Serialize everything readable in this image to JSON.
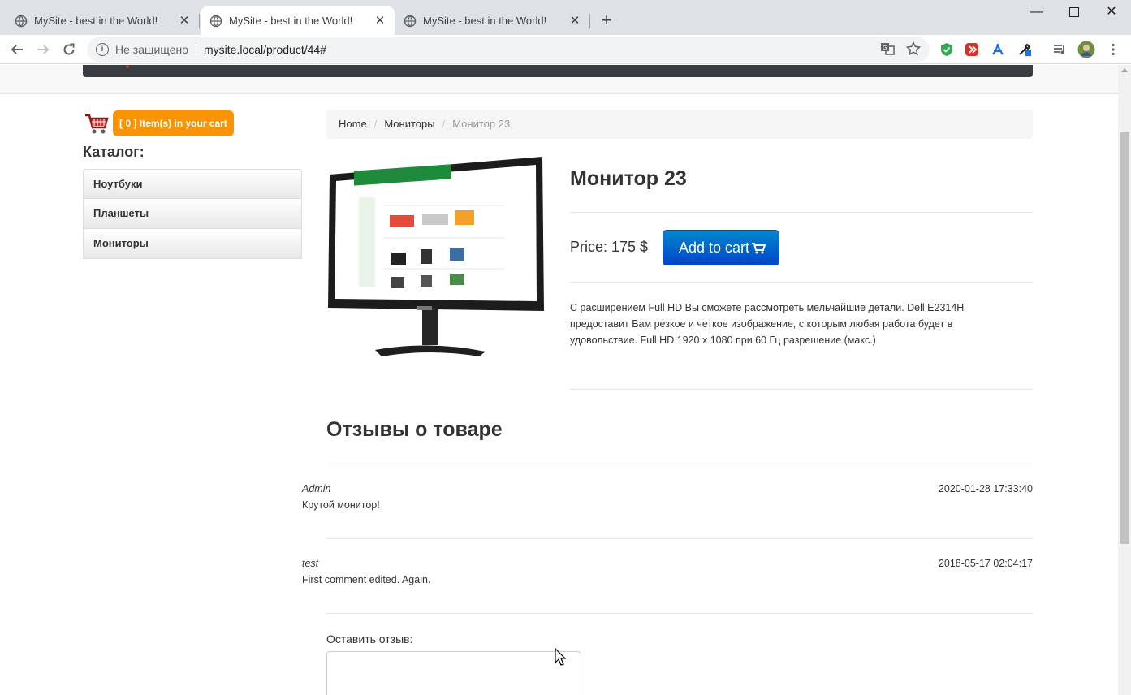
{
  "browser": {
    "tabs": [
      {
        "title": "MySite - best in the World!",
        "active": false
      },
      {
        "title": "MySite - best in the World!",
        "active": true
      },
      {
        "title": "MySite - best in the World!",
        "active": false
      }
    ],
    "new_tab_icon": "plus-icon",
    "window_controls": [
      "minimize-icon",
      "maximize-icon",
      "close-icon"
    ],
    "security_label": "Не защищено",
    "url": "mysite.local/product/44#",
    "extension_icons": [
      "translate-icon",
      "star-icon",
      "shield-icon",
      "extension-icon",
      "acrobat-icon",
      "eyedropper-icon",
      "media-icon",
      "avatar",
      "menu-icon"
    ]
  },
  "sidebar": {
    "cart_button": "[ 0 ] Item(s) in your cart",
    "catalog_title": "Каталог:",
    "catalog_items": [
      "Ноутбуки",
      "Планшеты",
      "Мониторы"
    ]
  },
  "breadcrumb": {
    "home": "Home",
    "category": "Мониторы",
    "current": "Монитор 23",
    "separator": "/"
  },
  "product": {
    "title": "Монитор 23",
    "price": "Price: 175 $",
    "add_to_cart": "Add to cart",
    "description": "С расширением Full HD Вы сможете рассмотреть мельчайшие детали. Dell E2314H предоставит Вам резкое и четкое изображение, с которым любая работа будет в удовольствие. Full HD 1920 x 1080 при 60 Гц разрешение (макс.)"
  },
  "reviews": {
    "title": "Отзывы о товаре",
    "items": [
      {
        "author": "Admin",
        "date": "2020-01-28 17:33:40",
        "text": "Крутой монитор!"
      },
      {
        "author": "test",
        "date": "2018-05-17 02:04:17",
        "text": "First comment edited. Again."
      }
    ],
    "leave_label": "Оставить отзыв:"
  },
  "colors": {
    "cart_orange": "#f89406",
    "button_blue": "#0044cc"
  }
}
